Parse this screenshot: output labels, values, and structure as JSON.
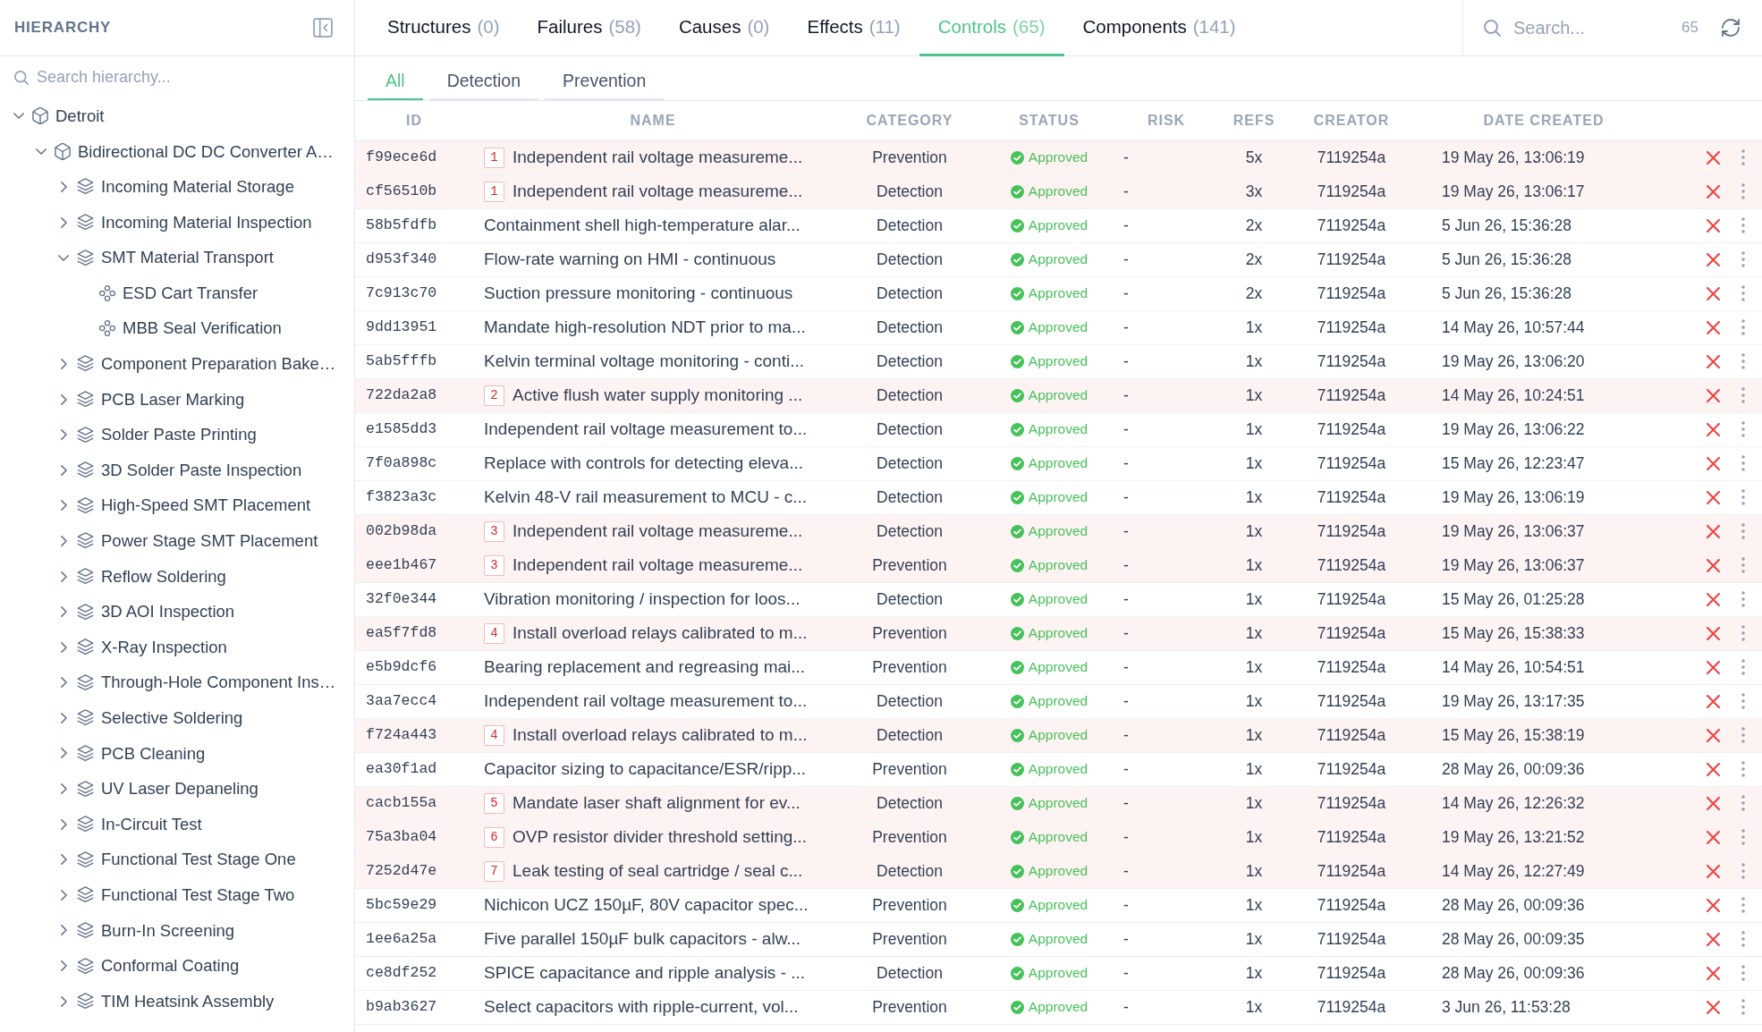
{
  "sidebar": {
    "title": "HIERARCHY",
    "search_placeholder": "Search hierarchy...",
    "tree": [
      {
        "label": "Detroit",
        "kind": "site",
        "expanded": true,
        "children": [
          {
            "label": "Bidirectional DC DC Converter A…",
            "kind": "product",
            "expanded": true,
            "children": [
              {
                "label": "Incoming Material Storage",
                "kind": "process",
                "expanded": false
              },
              {
                "label": "Incoming Material Inspection",
                "kind": "process",
                "expanded": false
              },
              {
                "label": "SMT Material Transport",
                "kind": "process",
                "expanded": true,
                "children": [
                  {
                    "label": "ESD Cart Transfer",
                    "kind": "step"
                  },
                  {
                    "label": "MBB Seal Verification",
                    "kind": "step"
                  }
                ]
              },
              {
                "label": "Component Preparation Bake…",
                "kind": "process",
                "expanded": false
              },
              {
                "label": "PCB Laser Marking",
                "kind": "process",
                "expanded": false
              },
              {
                "label": "Solder Paste Printing",
                "kind": "process",
                "expanded": false
              },
              {
                "label": "3D Solder Paste Inspection",
                "kind": "process",
                "expanded": false
              },
              {
                "label": "High-Speed SMT Placement",
                "kind": "process",
                "expanded": false
              },
              {
                "label": "Power Stage SMT Placement",
                "kind": "process",
                "expanded": false
              },
              {
                "label": "Reflow Soldering",
                "kind": "process",
                "expanded": false
              },
              {
                "label": "3D AOI Inspection",
                "kind": "process",
                "expanded": false
              },
              {
                "label": "X-Ray Inspection",
                "kind": "process",
                "expanded": false
              },
              {
                "label": "Through-Hole Component Ins…",
                "kind": "process",
                "expanded": false
              },
              {
                "label": "Selective Soldering",
                "kind": "process",
                "expanded": false
              },
              {
                "label": "PCB Cleaning",
                "kind": "process",
                "expanded": false
              },
              {
                "label": "UV Laser Depaneling",
                "kind": "process",
                "expanded": false
              },
              {
                "label": "In-Circuit Test",
                "kind": "process",
                "expanded": false
              },
              {
                "label": "Functional Test Stage One",
                "kind": "process",
                "expanded": false
              },
              {
                "label": "Functional Test Stage Two",
                "kind": "process",
                "expanded": false
              },
              {
                "label": "Burn-In Screening",
                "kind": "process",
                "expanded": false
              },
              {
                "label": "Conformal Coating",
                "kind": "process",
                "expanded": false
              },
              {
                "label": "TIM Heatsink Assembly",
                "kind": "process",
                "expanded": false
              }
            ]
          }
        ]
      }
    ]
  },
  "tabs": [
    {
      "label": "Structures",
      "count": "(0)",
      "selected": false
    },
    {
      "label": "Failures",
      "count": "(58)",
      "selected": false
    },
    {
      "label": "Causes",
      "count": "(0)",
      "selected": false
    },
    {
      "label": "Effects",
      "count": "(11)",
      "selected": false
    },
    {
      "label": "Controls",
      "count": "(65)",
      "selected": true
    },
    {
      "label": "Components",
      "count": "(141)",
      "selected": false
    }
  ],
  "search": {
    "placeholder": "Search...",
    "result_count": "65"
  },
  "subtabs": [
    {
      "label": "All",
      "selected": true
    },
    {
      "label": "Detection",
      "selected": false
    },
    {
      "label": "Prevention",
      "selected": false
    }
  ],
  "table": {
    "columns": [
      "ID",
      "NAME",
      "CATEGORY",
      "STATUS",
      "RISK",
      "REFS",
      "CREATOR",
      "DATE CREATED"
    ],
    "rows": [
      {
        "id": "f99ece6d",
        "badge": "1",
        "name": "Independent rail voltage measureme...",
        "category": "Prevention",
        "status": "Approved",
        "risk": "-",
        "refs": "5x",
        "creator": "7119254a",
        "date_created": "19 May 26, 13:06:19"
      },
      {
        "id": "cf56510b",
        "badge": "1",
        "name": "Independent rail voltage measureme...",
        "category": "Detection",
        "status": "Approved",
        "risk": "-",
        "refs": "3x",
        "creator": "7119254a",
        "date_created": "19 May 26, 13:06:17"
      },
      {
        "id": "58b5fdfb",
        "name": "Containment shell high-temperature alar...",
        "category": "Detection",
        "status": "Approved",
        "risk": "-",
        "refs": "2x",
        "creator": "7119254a",
        "date_created": "5 Jun 26, 15:36:28"
      },
      {
        "id": "d953f340",
        "name": "Flow-rate warning on HMI - continuous",
        "category": "Detection",
        "status": "Approved",
        "risk": "-",
        "refs": "2x",
        "creator": "7119254a",
        "date_created": "5 Jun 26, 15:36:28"
      },
      {
        "id": "7c913c70",
        "name": "Suction pressure monitoring - continuous",
        "category": "Detection",
        "status": "Approved",
        "risk": "-",
        "refs": "2x",
        "creator": "7119254a",
        "date_created": "5 Jun 26, 15:36:28"
      },
      {
        "id": "9dd13951",
        "name": "Mandate high-resolution NDT prior to ma...",
        "category": "Detection",
        "status": "Approved",
        "risk": "-",
        "refs": "1x",
        "creator": "7119254a",
        "date_created": "14 May 26, 10:57:44"
      },
      {
        "id": "5ab5fffb",
        "name": "Kelvin terminal voltage monitoring - conti...",
        "category": "Detection",
        "status": "Approved",
        "risk": "-",
        "refs": "1x",
        "creator": "7119254a",
        "date_created": "19 May 26, 13:06:20"
      },
      {
        "id": "722da2a8",
        "badge": "2",
        "name": "Active flush water supply monitoring ...",
        "category": "Detection",
        "status": "Approved",
        "risk": "-",
        "refs": "1x",
        "creator": "7119254a",
        "date_created": "14 May 26, 10:24:51"
      },
      {
        "id": "e1585dd3",
        "name": "Independent rail voltage measurement to...",
        "category": "Detection",
        "status": "Approved",
        "risk": "-",
        "refs": "1x",
        "creator": "7119254a",
        "date_created": "19 May 26, 13:06:22"
      },
      {
        "id": "7f0a898c",
        "name": "Replace with controls for detecting eleva...",
        "category": "Detection",
        "status": "Approved",
        "risk": "-",
        "refs": "1x",
        "creator": "7119254a",
        "date_created": "15 May 26, 12:23:47"
      },
      {
        "id": "f3823a3c",
        "name": "Kelvin 48-V rail measurement to MCU - c...",
        "category": "Detection",
        "status": "Approved",
        "risk": "-",
        "refs": "1x",
        "creator": "7119254a",
        "date_created": "19 May 26, 13:06:19"
      },
      {
        "id": "002b98da",
        "badge": "3",
        "name": "Independent rail voltage measureme...",
        "category": "Detection",
        "status": "Approved",
        "risk": "-",
        "refs": "1x",
        "creator": "7119254a",
        "date_created": "19 May 26, 13:06:37"
      },
      {
        "id": "eee1b467",
        "badge": "3",
        "name": "Independent rail voltage measureme...",
        "category": "Prevention",
        "status": "Approved",
        "risk": "-",
        "refs": "1x",
        "creator": "7119254a",
        "date_created": "19 May 26, 13:06:37"
      },
      {
        "id": "32f0e344",
        "name": "Vibration monitoring / inspection for loos...",
        "category": "Detection",
        "status": "Approved",
        "risk": "-",
        "refs": "1x",
        "creator": "7119254a",
        "date_created": "15 May 26, 01:25:28"
      },
      {
        "id": "ea5f7fd8",
        "badge": "4",
        "name": "Install overload relays calibrated to m...",
        "category": "Prevention",
        "status": "Approved",
        "risk": "-",
        "refs": "1x",
        "creator": "7119254a",
        "date_created": "15 May 26, 15:38:33"
      },
      {
        "id": "e5b9dcf6",
        "name": "Bearing replacement and regreasing mai...",
        "category": "Prevention",
        "status": "Approved",
        "risk": "-",
        "refs": "1x",
        "creator": "7119254a",
        "date_created": "14 May 26, 10:54:51"
      },
      {
        "id": "3aa7ecc4",
        "name": "Independent rail voltage measurement to...",
        "category": "Detection",
        "status": "Approved",
        "risk": "-",
        "refs": "1x",
        "creator": "7119254a",
        "date_created": "19 May 26, 13:17:35"
      },
      {
        "id": "f724a443",
        "badge": "4",
        "name": "Install overload relays calibrated to m...",
        "category": "Detection",
        "status": "Approved",
        "risk": "-",
        "refs": "1x",
        "creator": "7119254a",
        "date_created": "15 May 26, 15:38:19"
      },
      {
        "id": "ea30f1ad",
        "name": "Capacitor sizing to capacitance/ESR/ripp...",
        "category": "Prevention",
        "status": "Approved",
        "risk": "-",
        "refs": "1x",
        "creator": "7119254a",
        "date_created": "28 May 26, 00:09:36"
      },
      {
        "id": "cacb155a",
        "badge": "5",
        "name": "Mandate laser shaft alignment for ev...",
        "category": "Detection",
        "status": "Approved",
        "risk": "-",
        "refs": "1x",
        "creator": "7119254a",
        "date_created": "14 May 26, 12:26:32"
      },
      {
        "id": "75a3ba04",
        "badge": "6",
        "name": "OVP resistor divider threshold setting...",
        "category": "Prevention",
        "status": "Approved",
        "risk": "-",
        "refs": "1x",
        "creator": "7119254a",
        "date_created": "19 May 26, 13:21:52"
      },
      {
        "id": "7252d47e",
        "badge": "7",
        "name": "Leak testing of seal cartridge / seal c...",
        "category": "Detection",
        "status": "Approved",
        "risk": "-",
        "refs": "1x",
        "creator": "7119254a",
        "date_created": "14 May 26, 12:27:49"
      },
      {
        "id": "5bc59e29",
        "name": "Nichicon UCZ 150µF, 80V capacitor spec...",
        "category": "Prevention",
        "status": "Approved",
        "risk": "-",
        "refs": "1x",
        "creator": "7119254a",
        "date_created": "28 May 26, 00:09:36"
      },
      {
        "id": "1ee6a25a",
        "name": "Five parallel 150µF bulk capacitors - alw...",
        "category": "Prevention",
        "status": "Approved",
        "risk": "-",
        "refs": "1x",
        "creator": "7119254a",
        "date_created": "28 May 26, 00:09:35"
      },
      {
        "id": "ce8df252",
        "name": "SPICE capacitance and ripple analysis - ...",
        "category": "Detection",
        "status": "Approved",
        "risk": "-",
        "refs": "1x",
        "creator": "7119254a",
        "date_created": "28 May 26, 00:09:36"
      },
      {
        "id": "b9ab3627",
        "name": "Select capacitors with ripple-current, vol...",
        "category": "Prevention",
        "status": "Approved",
        "risk": "-",
        "refs": "1x",
        "creator": "7119254a",
        "date_created": "3 Jun 26, 11:53:28"
      }
    ]
  }
}
